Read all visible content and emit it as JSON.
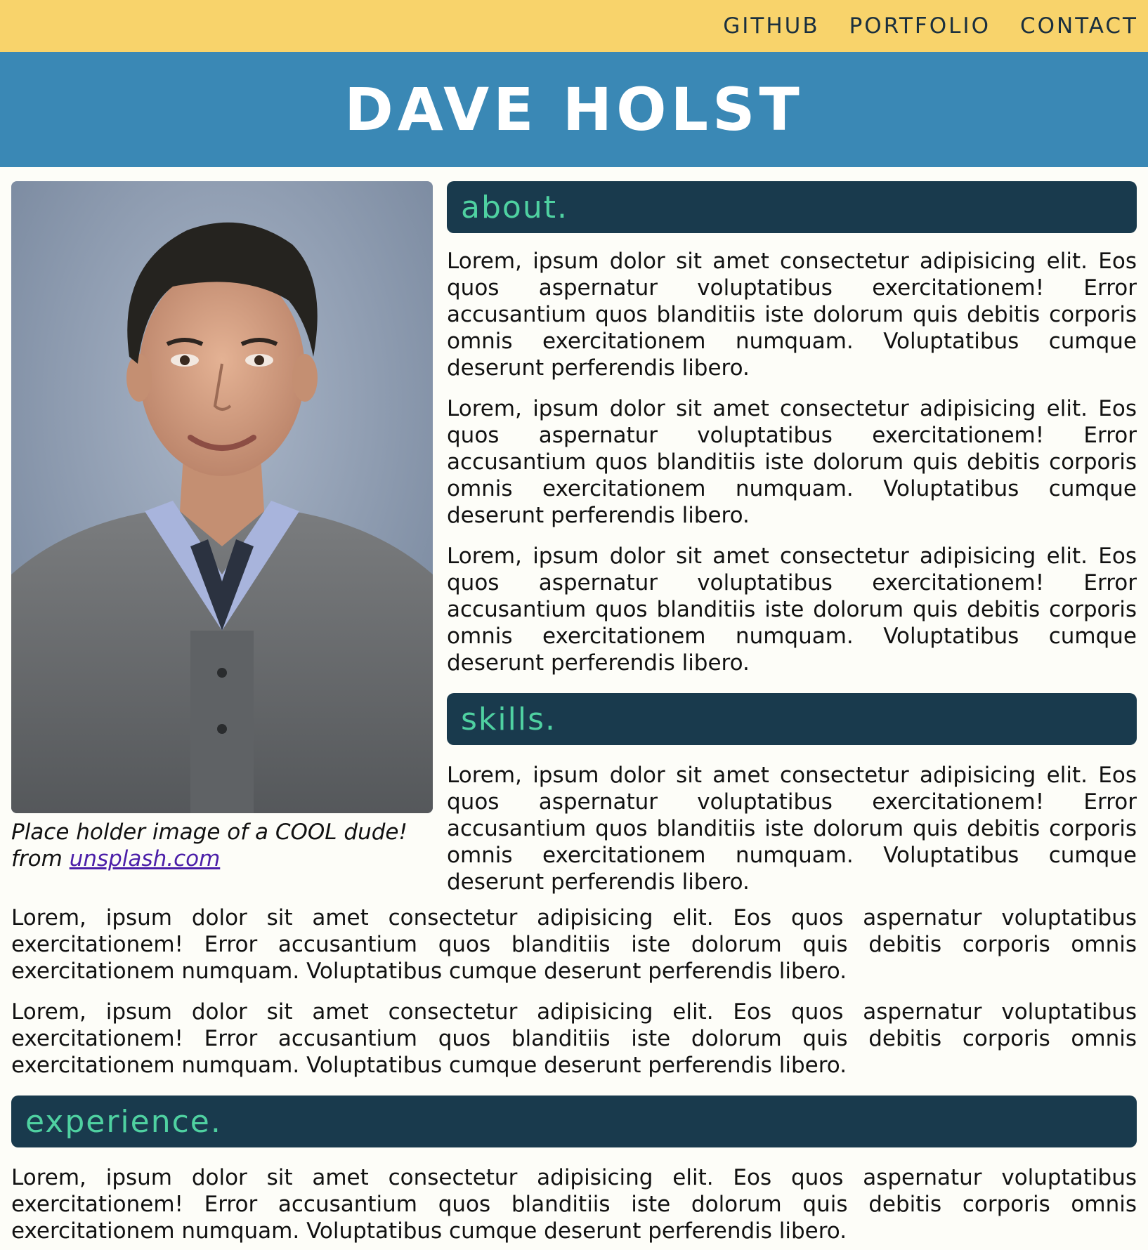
{
  "nav": {
    "links": [
      "GITHUB",
      "PORTFOLIO",
      "CONTACT"
    ]
  },
  "header": {
    "title": "DAVE HOLST"
  },
  "photo": {
    "caption_text": "Place holder image of a COOL dude! from ",
    "caption_link": "unsplash.com"
  },
  "sections": {
    "about": {
      "heading": "about.",
      "paragraphs": [
        "Lorem, ipsum dolor sit amet consectetur adipisicing elit. Eos quos aspernatur voluptatibus exercitationem! Error accusantium quos blanditiis iste dolorum quis debitis corporis omnis exercitationem numquam. Voluptatibus cumque deserunt perferendis libero.",
        "Lorem, ipsum dolor sit amet consectetur adipisicing elit. Eos quos aspernatur voluptatibus exercitationem! Error accusantium quos blanditiis iste dolorum quis debitis corporis omnis exercitationem numquam. Voluptatibus cumque deserunt perferendis libero.",
        "Lorem, ipsum dolor sit amet consectetur adipisicing elit. Eos quos aspernatur voluptatibus exercitationem! Error accusantium quos blanditiis iste dolorum quis debitis corporis omnis exercitationem numquam. Voluptatibus cumque deserunt perferendis libero."
      ]
    },
    "skills": {
      "heading": "skills.",
      "paragraphs": [
        "Lorem, ipsum dolor sit amet consectetur adipisicing elit. Eos quos aspernatur voluptatibus exercitationem! Error accusantium quos blanditiis iste dolorum quis debitis corporis omnis exercitationem numquam. Voluptatibus cumque deserunt perferendis libero.",
        "Lorem, ipsum dolor sit amet consectetur adipisicing elit. Eos quos aspernatur voluptatibus exercitationem! Error accusantium quos blanditiis iste dolorum quis debitis corporis omnis exercitationem numquam. Voluptatibus cumque deserunt perferendis libero.",
        "Lorem, ipsum dolor sit amet consectetur adipisicing elit. Eos quos aspernatur voluptatibus exercitationem! Error accusantium quos blanditiis iste dolorum quis debitis corporis omnis exercitationem numquam. Voluptatibus cumque deserunt perferendis libero."
      ]
    },
    "experience": {
      "heading": "experience.",
      "paragraphs": [
        "Lorem, ipsum dolor sit amet consectetur adipisicing elit. Eos quos aspernatur voluptatibus exercitationem! Error accusantium quos blanditiis iste dolorum quis debitis corporis omnis exercitationem numquam. Voluptatibus cumque deserunt perferendis libero."
      ]
    }
  },
  "colors": {
    "nav_bg": "#f8d36b",
    "banner_bg": "#3a88b5",
    "section_bg": "#193a4d",
    "section_text": "#4fd1a1",
    "link": "#4b1ea8"
  }
}
